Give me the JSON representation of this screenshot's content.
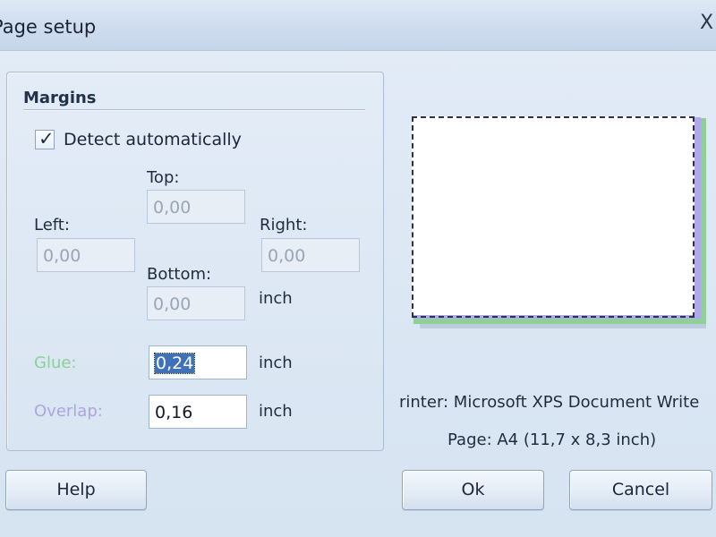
{
  "window": {
    "title": "Page setup",
    "close_glyph": "X"
  },
  "margins": {
    "group_title": "Margins",
    "detect_automatically": {
      "label": "Detect automatically",
      "checked": true
    },
    "top_label": "Top:",
    "top_value": "0,00",
    "left_label": "Left:",
    "left_value": "0,00",
    "right_label": "Right:",
    "right_value": "0,00",
    "bottom_label": "Bottom:",
    "bottom_value": "0,00",
    "margin_unit": "inch",
    "glue_label": "Glue:",
    "glue_value": "0,24",
    "glue_unit": "inch",
    "overlap_label": "Overlap:",
    "overlap_value": "0,16",
    "overlap_unit": "inch"
  },
  "preview": {
    "printer_text": "rinter: Microsoft XPS Document Write",
    "page_text": "Page: A4 (11,7 x 8,3 inch)",
    "colors": {
      "glue": "#91cf9a",
      "overlap": "#b2a9ea",
      "page": "#ffffff"
    }
  },
  "buttons": {
    "help": "Help",
    "ok": "Ok",
    "cancel": "Cancel"
  }
}
